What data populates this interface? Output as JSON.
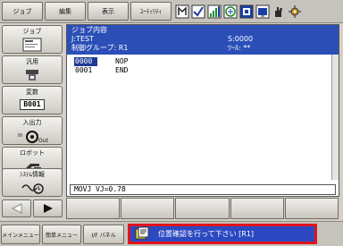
{
  "menu": {
    "job": "ジョブ",
    "edit": "編集",
    "display": "表示",
    "utility": "ﾕｰﾃｨﾘﾃｨ"
  },
  "status_icons": [
    "robot-axis-icon",
    "check-box-icon",
    "signal-icon",
    "keyboard-icon",
    "coordinate-icon",
    "step-icon",
    "hand-icon",
    "gear-robot-icon"
  ],
  "sidebar": {
    "job": {
      "label": "ジョブ",
      "icon": "job-document-icon"
    },
    "variable": {
      "label": "汎用",
      "icon": "tool-icon"
    },
    "variable_field": "B001",
    "variable_label": "変数",
    "io": {
      "label": "入出力",
      "icon": "io-in-out-icon"
    },
    "robot": {
      "label": "ロボット",
      "icon": "robot-arm-icon"
    },
    "system": {
      "label": "ｼｽﾃﾑ情報",
      "icon": "system-info-icon"
    }
  },
  "panel": {
    "title": "ジョブ内容",
    "job_name": "J:TEST",
    "step": "S:0000",
    "control_group": "制御グループ: R1",
    "tool": "ﾂｰﾙ: **",
    "lines": [
      {
        "no": "0000",
        "cmd": "NOP",
        "current": true
      },
      {
        "no": "0001",
        "cmd": "END",
        "current": false
      }
    ],
    "input_line": "MOVJ VJ=0.78"
  },
  "bottom": {
    "main_menu": "メインメニュー",
    "simple_menu": "簡単メニュー",
    "io_panel": "I/F パネル",
    "message": "位置確認を行って下さい [R1]"
  },
  "colors": {
    "accent": "#2b4fb7",
    "highlight_border": "#e0141c",
    "background": "#d4d0c8"
  }
}
